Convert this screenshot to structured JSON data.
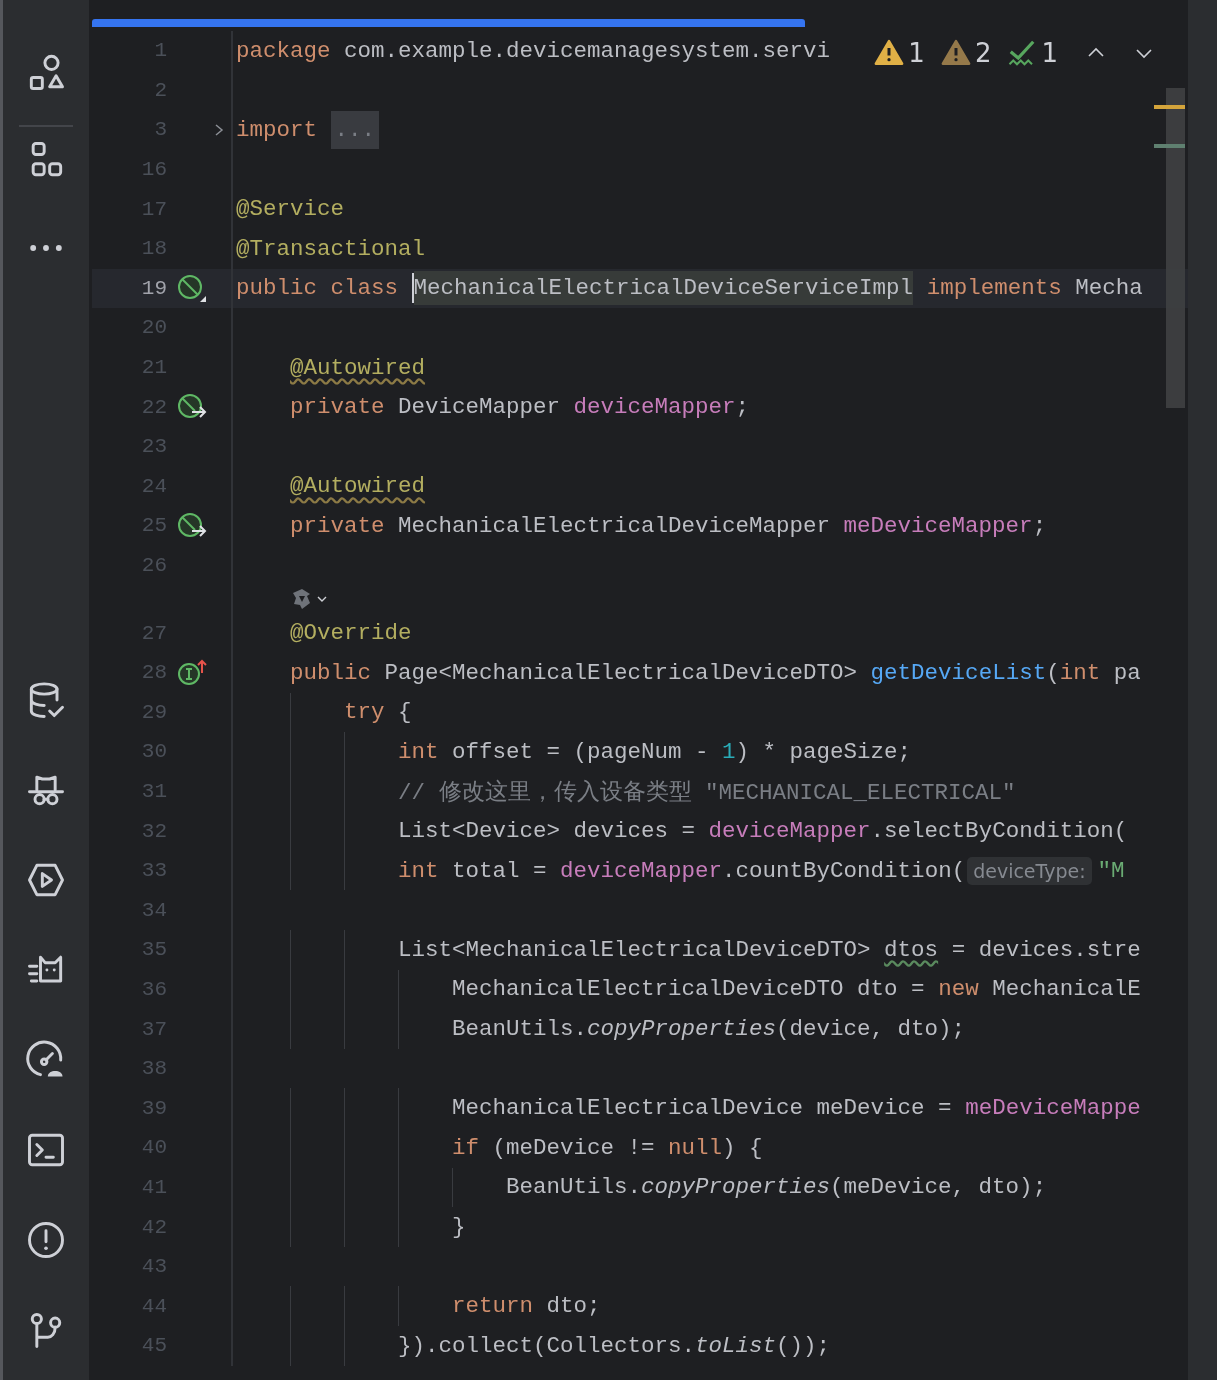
{
  "toolbar": {
    "top": [
      {
        "kind": "shapes"
      },
      {
        "kind": "modules"
      },
      {
        "kind": "more"
      }
    ],
    "bottom": [
      {
        "kind": "database"
      },
      {
        "kind": "incognito"
      },
      {
        "kind": "play"
      },
      {
        "kind": "cat"
      },
      {
        "kind": "gauge"
      },
      {
        "kind": "terminal"
      },
      {
        "kind": "problems"
      },
      {
        "kind": "branch"
      }
    ]
  },
  "inspections": [
    {
      "kind": "warning",
      "count": "1"
    },
    {
      "kind": "weak_warning",
      "count": "2"
    },
    {
      "kind": "typo",
      "count": "1"
    }
  ],
  "lines": [
    {
      "kind": "code",
      "number": "1",
      "tokens": [
        {
          "kind": "kw",
          "text": "package"
        },
        {
          "kind": "plain",
          "text": " com.example.devicemanagesystem.servi"
        }
      ]
    },
    {
      "kind": "code",
      "number": "2"
    },
    {
      "kind": "code",
      "number": "3",
      "gutter": {
        "kind": "fold"
      },
      "tokens": [
        {
          "kind": "kw",
          "text": "import"
        },
        {
          "kind": "fold",
          "text": "..."
        }
      ]
    },
    {
      "kind": "code",
      "number": "16"
    },
    {
      "kind": "code",
      "number": "17",
      "tokens": [
        {
          "kind": "ann",
          "text": "@Service"
        }
      ]
    },
    {
      "kind": "code",
      "number": "18",
      "tokens": [
        {
          "kind": "ann",
          "text": "@Transactional"
        }
      ]
    },
    {
      "kind": "code",
      "number": "19",
      "current": true,
      "gutter": {
        "kind": "bean"
      },
      "tokens": [
        {
          "kind": "kw",
          "text": "public class "
        },
        {
          "kind": "highlight",
          "text": "MechanicalElectricalDeviceServiceImpl"
        },
        {
          "kind": "kw",
          "text": " implements"
        },
        {
          "kind": "plain",
          "text": " Mecha"
        }
      ]
    },
    {
      "kind": "code",
      "number": "20"
    },
    {
      "kind": "code",
      "number": "21",
      "block": {
        "kind": "class"
      },
      "tokens": [
        {
          "kind": "ann_warn",
          "text": "@Autowired"
        }
      ]
    },
    {
      "kind": "code",
      "number": "22",
      "block": {
        "kind": "class"
      },
      "gutter": {
        "kind": "autowire"
      },
      "tokens": [
        {
          "kind": "kw",
          "text": "private"
        },
        {
          "kind": "plain",
          "text": " DeviceMapper "
        },
        {
          "kind": "field",
          "text": "deviceMapper"
        },
        {
          "kind": "plain",
          "text": ";"
        }
      ]
    },
    {
      "kind": "code",
      "number": "23"
    },
    {
      "kind": "code",
      "number": "24",
      "block": {
        "kind": "class"
      },
      "tokens": [
        {
          "kind": "ann_warn",
          "text": "@Autowired"
        }
      ]
    },
    {
      "kind": "code",
      "number": "25",
      "block": {
        "kind": "class"
      },
      "gutter": {
        "kind": "autowire"
      },
      "tokens": [
        {
          "kind": "kw",
          "text": "private"
        },
        {
          "kind": "plain",
          "text": " MechanicalElectricalDeviceMapper "
        },
        {
          "kind": "field",
          "text": "meDeviceMapper"
        },
        {
          "kind": "plain",
          "text": ";"
        }
      ]
    },
    {
      "kind": "code",
      "number": "26"
    },
    {
      "kind": "inlay",
      "block": {
        "kind": "class"
      }
    },
    {
      "kind": "code",
      "number": "27",
      "block": {
        "kind": "class"
      },
      "tokens": [
        {
          "kind": "ann",
          "text": "@Override"
        }
      ]
    },
    {
      "kind": "code",
      "number": "28",
      "block": {
        "kind": "class"
      },
      "gutter": {
        "kind": "implement"
      },
      "tokens": [
        {
          "kind": "kw",
          "text": "public"
        },
        {
          "kind": "plain",
          "text": " Page<MechanicalElectricalDeviceDTO> "
        },
        {
          "kind": "method",
          "text": "getDeviceList"
        },
        {
          "kind": "plain",
          "text": "("
        },
        {
          "kind": "kw",
          "text": "int"
        },
        {
          "kind": "plain",
          "text": " pa"
        }
      ]
    },
    {
      "kind": "code",
      "number": "29",
      "block": {
        "kind": "method"
      },
      "tokens": [
        {
          "kind": "kw",
          "text": "try"
        },
        {
          "kind": "plain",
          "text": " {"
        }
      ]
    },
    {
      "kind": "code",
      "number": "30",
      "block": {
        "kind": "try"
      },
      "tokens": [
        {
          "kind": "kw",
          "text": "int"
        },
        {
          "kind": "plain",
          "text": " offset = (pageNum - "
        },
        {
          "kind": "num",
          "text": "1"
        },
        {
          "kind": "plain",
          "text": ") * pageSize;"
        }
      ]
    },
    {
      "kind": "code",
      "number": "31",
      "block": {
        "kind": "try"
      },
      "tokens": [
        {
          "kind": "comment",
          "text": "// 修改这里，传入设备类型 \"MECHANICAL_ELECTRICAL\""
        }
      ]
    },
    {
      "kind": "code",
      "number": "32",
      "block": {
        "kind": "try"
      },
      "tokens": [
        {
          "kind": "plain",
          "text": "List<Device> devices = "
        },
        {
          "kind": "field",
          "text": "deviceMapper"
        },
        {
          "kind": "plain",
          "text": ".selectByCondition("
        }
      ]
    },
    {
      "kind": "code",
      "number": "33",
      "block": {
        "kind": "try"
      },
      "tokens": [
        {
          "kind": "kw",
          "text": "int"
        },
        {
          "kind": "plain",
          "text": " total = "
        },
        {
          "kind": "field",
          "text": "deviceMapper"
        },
        {
          "kind": "plain",
          "text": ".countByCondition("
        },
        {
          "kind": "hint",
          "text": "deviceType:"
        },
        {
          "kind": "string",
          "text": "\"M"
        }
      ]
    },
    {
      "kind": "code",
      "number": "34"
    },
    {
      "kind": "code",
      "number": "35",
      "block": {
        "kind": "try"
      },
      "tokens": [
        {
          "kind": "plain",
          "text": "List<MechanicalElectricalDeviceDTO> "
        },
        {
          "kind": "typo",
          "text": "dtos"
        },
        {
          "kind": "plain",
          "text": " = devices.stre"
        }
      ]
    },
    {
      "kind": "code",
      "number": "36",
      "block": {
        "kind": "lambda"
      },
      "tokens": [
        {
          "kind": "plain",
          "text": "MechanicalElectricalDeviceDTO dto = "
        },
        {
          "kind": "kw",
          "text": "new"
        },
        {
          "kind": "plain",
          "text": " MechanicalE"
        }
      ]
    },
    {
      "kind": "code",
      "number": "37",
      "block": {
        "kind": "lambda"
      },
      "tokens": [
        {
          "kind": "plain",
          "text": "BeanUtils."
        },
        {
          "kind": "italic",
          "text": "copyProperties"
        },
        {
          "kind": "plain",
          "text": "(device, dto);"
        }
      ]
    },
    {
      "kind": "code",
      "number": "38"
    },
    {
      "kind": "code",
      "number": "39",
      "block": {
        "kind": "lambda"
      },
      "tokens": [
        {
          "kind": "plain",
          "text": "MechanicalElectricalDevice meDevice = "
        },
        {
          "kind": "field",
          "text": "meDeviceMappe"
        }
      ]
    },
    {
      "kind": "code",
      "number": "40",
      "block": {
        "kind": "lambda"
      },
      "tokens": [
        {
          "kind": "kw",
          "text": "if"
        },
        {
          "kind": "plain",
          "text": " (meDevice != "
        },
        {
          "kind": "kw",
          "text": "null"
        },
        {
          "kind": "plain",
          "text": ") {"
        }
      ]
    },
    {
      "kind": "code",
      "number": "41",
      "block": {
        "kind": "if"
      },
      "tokens": [
        {
          "kind": "plain",
          "text": "BeanUtils."
        },
        {
          "kind": "italic",
          "text": "copyProperties"
        },
        {
          "kind": "plain",
          "text": "(meDevice, dto);"
        }
      ]
    },
    {
      "kind": "code",
      "number": "42",
      "block": {
        "kind": "lambda"
      },
      "tokens": [
        {
          "kind": "plain",
          "text": "}"
        }
      ]
    },
    {
      "kind": "code",
      "number": "43"
    },
    {
      "kind": "code",
      "number": "44",
      "block": {
        "kind": "lambda"
      },
      "tokens": [
        {
          "kind": "kw",
          "text": "return"
        },
        {
          "kind": "plain",
          "text": " dto;"
        }
      ]
    },
    {
      "kind": "code",
      "number": "45",
      "block": {
        "kind": "try"
      },
      "tokens": [
        {
          "kind": "plain",
          "text": "}).collect(Collectors."
        },
        {
          "kind": "italic",
          "text": "toList"
        },
        {
          "kind": "plain",
          "text": "());"
        }
      ]
    }
  ]
}
